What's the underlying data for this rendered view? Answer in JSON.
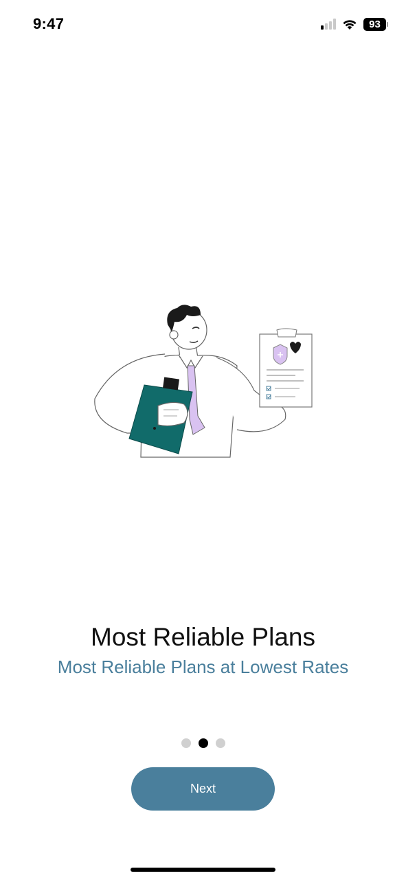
{
  "status_bar": {
    "time": "9:47",
    "battery_level": "93",
    "signal_bars_active": 1,
    "signal_bars_total": 4,
    "icons": [
      "signal-icon",
      "wifi-icon",
      "battery-icon"
    ]
  },
  "onboarding": {
    "title": "Most Reliable Plans",
    "subtitle": "Most Reliable Plans at Lowest Rates",
    "page_count": 3,
    "current_page": 2,
    "next_label": "Next"
  },
  "colors": {
    "accent": "#4a7f9c",
    "folder": "#116b6a",
    "tie": "#d9c2f1",
    "dot_inactive": "#d0d0d0",
    "dot_active": "#000000"
  }
}
